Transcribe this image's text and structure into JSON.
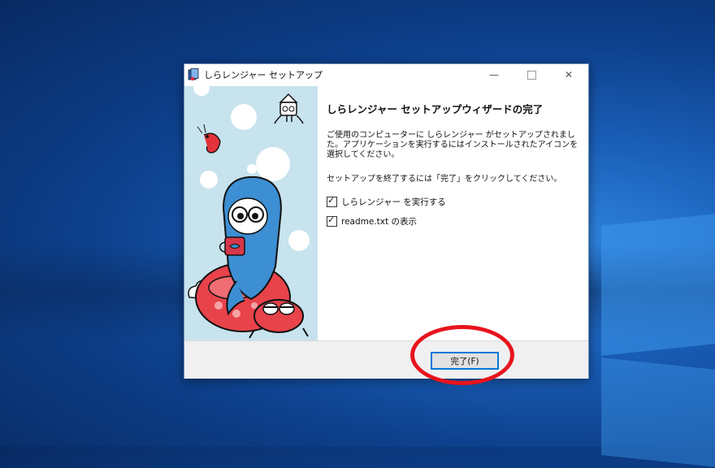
{
  "window": {
    "title": "しらレンジャー セットアップ",
    "controls": {
      "minimize": "—",
      "close": "✕"
    }
  },
  "content": {
    "heading": "しらレンジャー セットアップウィザードの完了",
    "paragraph1": "ご使用のコンピューターに しらレンジャー がセットアップされました。アプリケーションを実行するにはインストールされたアイコンを選択してください。",
    "paragraph2": "セットアップを終了するには「完了」をクリックしてください。",
    "checkboxes": [
      {
        "label": "しらレンジャー を実行する",
        "checked": true
      },
      {
        "label": "readme.txt の表示",
        "checked": true
      }
    ]
  },
  "footer": {
    "finish_label": "完了(F)"
  },
  "colors": {
    "highlight": "#e8141c",
    "accent": "#0078d7",
    "art_background": "#c7e3ee"
  }
}
